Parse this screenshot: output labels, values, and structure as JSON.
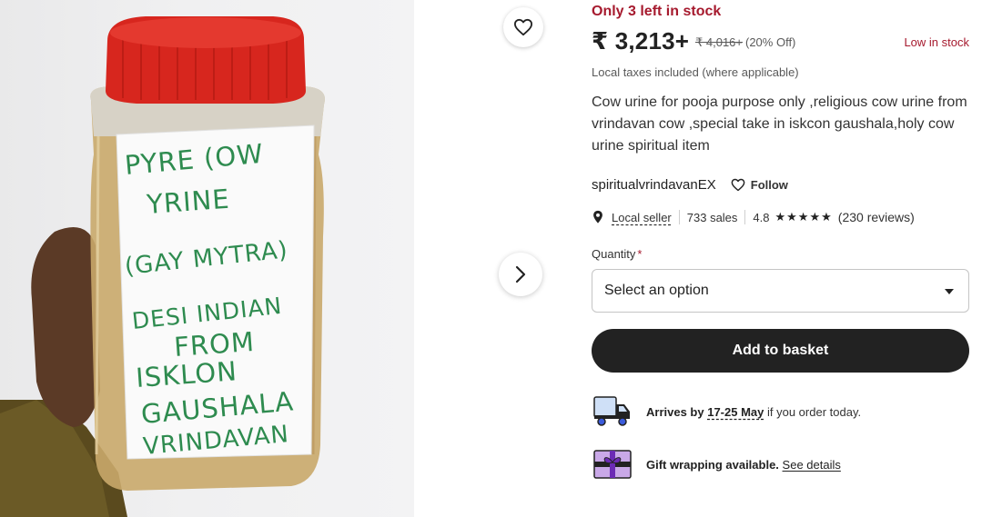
{
  "photo": {
    "label_lines": [
      "PYRE (OW",
      "YRINE",
      "(GAY MYTRA)",
      "DESI INDIAN",
      "FROM",
      "ISKLON",
      "GAUSHALA",
      "VRINDAVAN"
    ]
  },
  "icons": {
    "favorite": "heart-outline-icon",
    "next": "chevron-right-icon",
    "location": "map-pin-icon",
    "follow": "heart-outline-icon",
    "delivery": "delivery-truck-icon",
    "gift": "gift-box-icon"
  },
  "colors": {
    "alert": "#a61a2e",
    "button": "#222222",
    "muted": "#595959"
  },
  "listing": {
    "stock_alert": "Only 3 left in stock",
    "price": "₹ 3,213+",
    "original_price": "₹ 4,016+",
    "discount": "(20% Off)",
    "low_stock": "Low in stock",
    "taxes_note": "Local taxes included (where applicable)",
    "description": "Cow urine for pooja purpose only ,religious cow urine from vrindavan cow ,special take in iskcon gaushala,holy cow urine spiritual item"
  },
  "seller": {
    "name": "spiritualvrindavanEX",
    "follow_label": "Follow",
    "local_seller_label": "Local seller",
    "sales": "733 sales",
    "rating": "4.8",
    "stars": "★★★★★",
    "star_count": 5,
    "reviews": "(230 reviews)"
  },
  "quantity": {
    "label": "Quantity",
    "required_mark": "*",
    "selected": "Select an option"
  },
  "cta": {
    "add_to_basket": "Add to basket"
  },
  "shipping": {
    "prefix": "Arrives by",
    "dates": "17-25 May",
    "suffix": "if you order today."
  },
  "gift": {
    "text": "Gift wrapping available.",
    "link": "See details"
  }
}
